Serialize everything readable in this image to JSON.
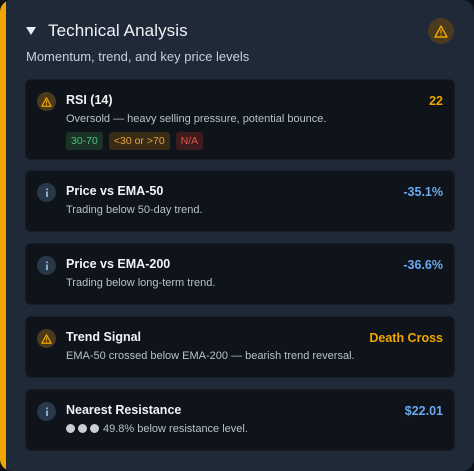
{
  "section": {
    "title": "Technical Analysis",
    "subtitle": "Momentum, trend, and key price levels",
    "header_icon": "warning-icon",
    "accent_color": "#f0a500"
  },
  "cards": [
    {
      "icon": "warning-icon",
      "title": "RSI (14)",
      "description": "Oversold — heavy selling pressure, potential bounce.",
      "value": "22",
      "value_color": "#f0a500",
      "badges": [
        {
          "label": "30-70",
          "tone": "green"
        },
        {
          "label": "<30 or >70",
          "tone": "orange"
        },
        {
          "label": "N/A",
          "tone": "red"
        }
      ]
    },
    {
      "icon": "info-icon",
      "title": "Price vs EMA-50",
      "description": "Trading below 50-day trend.",
      "value": "-35.1%",
      "value_color": "#6ba8f0"
    },
    {
      "icon": "info-icon",
      "title": "Price vs EMA-200",
      "description": "Trading below long-term trend.",
      "value": "-36.6%",
      "value_color": "#6ba8f0"
    },
    {
      "icon": "warning-icon",
      "title": "Trend Signal",
      "description": "EMA-50 crossed below EMA-200 — bearish trend reversal.",
      "value": "Death Cross",
      "value_color": "#f0a500"
    },
    {
      "icon": "info-icon",
      "title": "Nearest Resistance",
      "description": "49.8% below resistance level.",
      "strength_dots": 3,
      "value": "$22.01",
      "value_color": "#6ba8f0"
    }
  ]
}
